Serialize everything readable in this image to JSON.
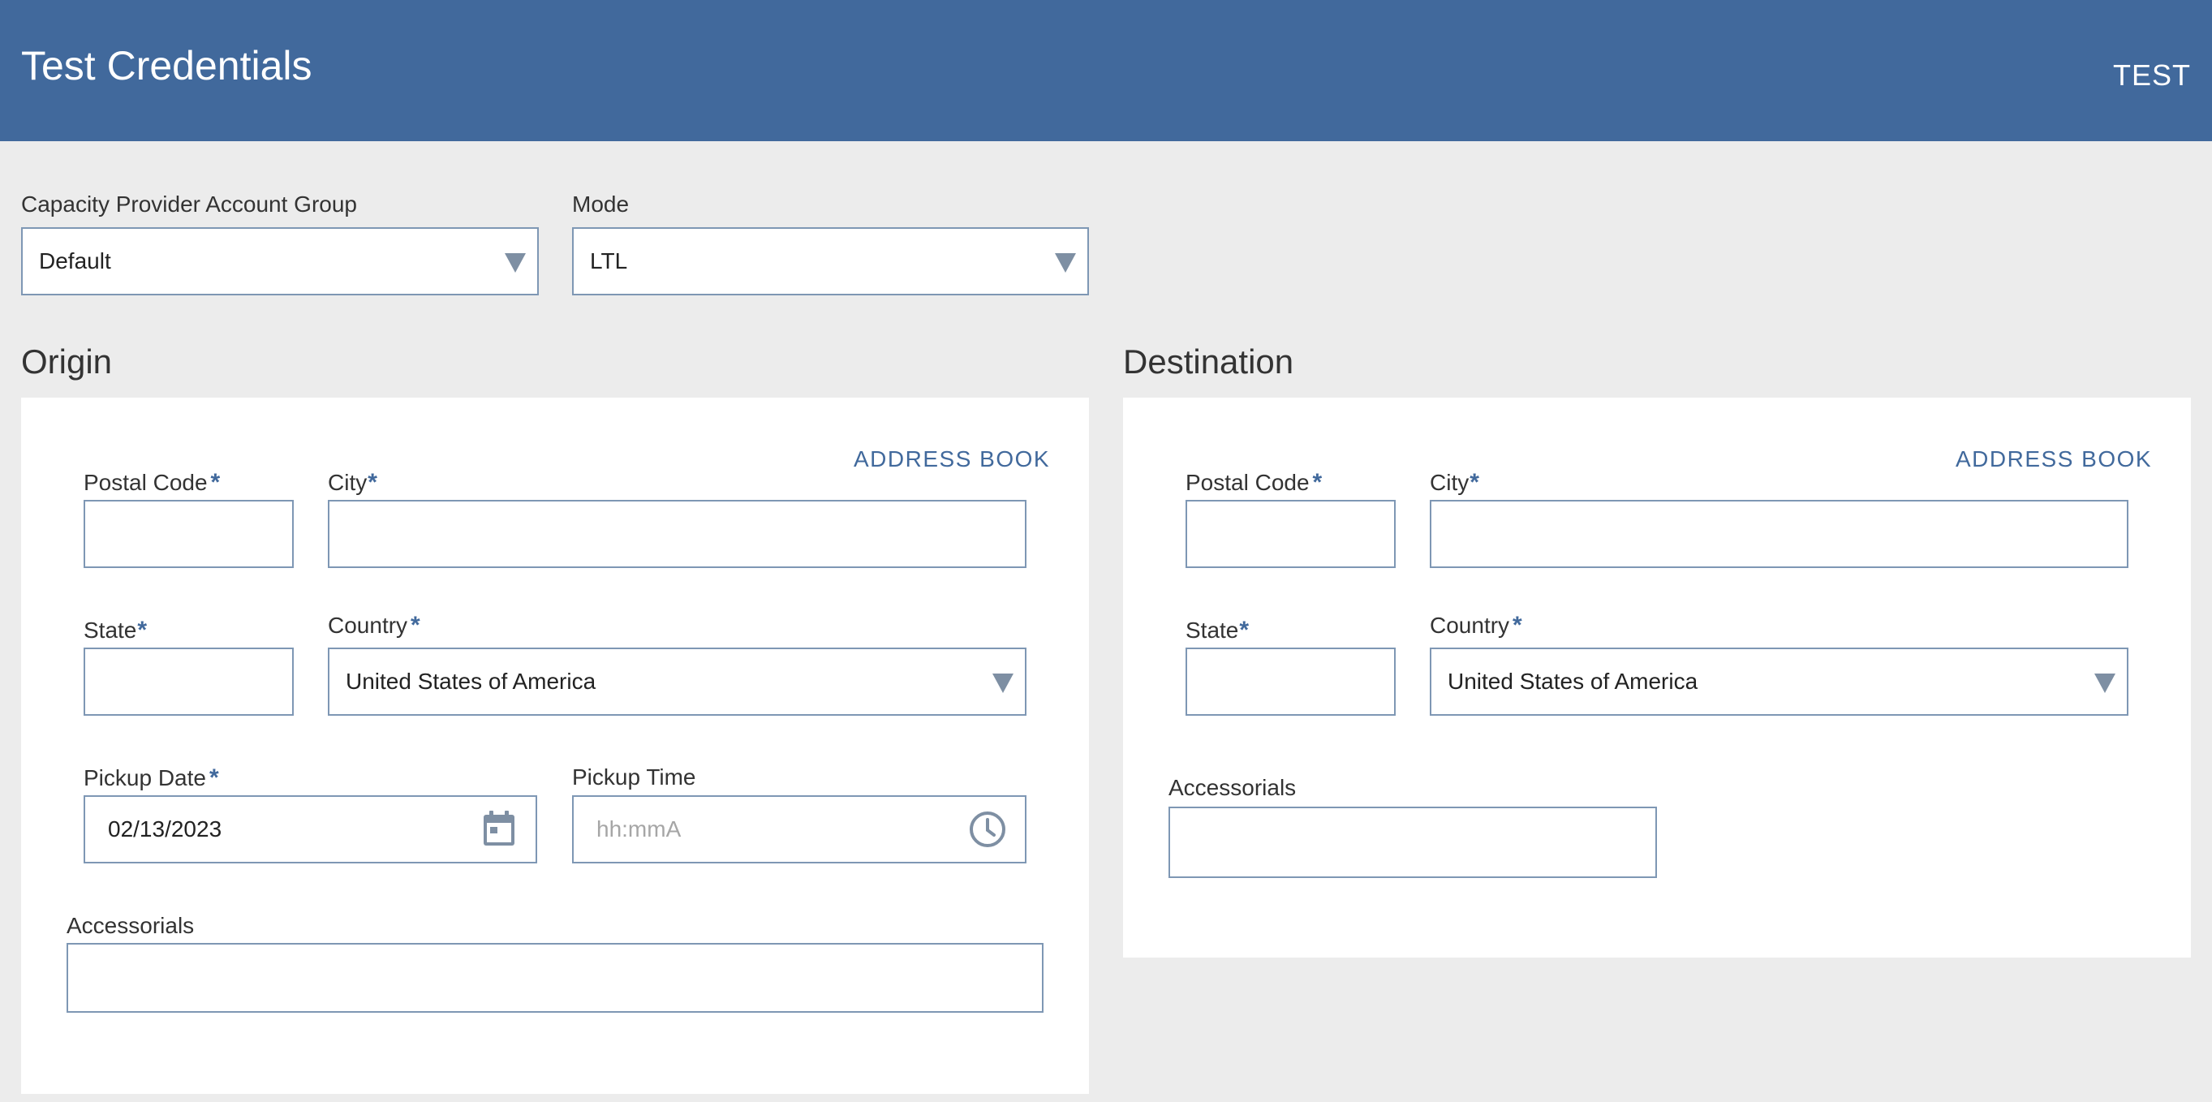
{
  "header": {
    "title": "Test Credentials",
    "environment": "TEST"
  },
  "filters": {
    "account_group": {
      "label": "Capacity Provider Account Group",
      "value": "Default"
    },
    "mode": {
      "label": "Mode",
      "value": "LTL"
    }
  },
  "origin": {
    "title": "Origin",
    "address_book": "ADDRESS BOOK",
    "postal_code": {
      "label": "Postal Code",
      "value": ""
    },
    "city": {
      "label": "City",
      "value": ""
    },
    "state": {
      "label": "State",
      "value": ""
    },
    "country": {
      "label": "Country",
      "value": "United States of America"
    },
    "pickup_date": {
      "label": "Pickup Date",
      "value": "02/13/2023"
    },
    "pickup_time": {
      "label": "Pickup Time",
      "placeholder": "hh:mmA",
      "value": ""
    },
    "accessorials": {
      "label": "Accessorials",
      "value": ""
    }
  },
  "destination": {
    "title": "Destination",
    "address_book": "ADDRESS BOOK",
    "postal_code": {
      "label": "Postal Code",
      "value": ""
    },
    "city": {
      "label": "City",
      "value": ""
    },
    "state": {
      "label": "State",
      "value": ""
    },
    "country": {
      "label": "Country",
      "value": "United States of America"
    },
    "accessorials": {
      "label": "Accessorials",
      "value": ""
    }
  },
  "required_marker": "*",
  "icons": {
    "dropdown": "caret-down-icon",
    "date": "calendar-icon",
    "time": "clock-icon"
  },
  "colors": {
    "header_bg": "#41699c",
    "accent": "#41699c",
    "page_bg": "#ececec",
    "field_border": "#7e97b4"
  }
}
